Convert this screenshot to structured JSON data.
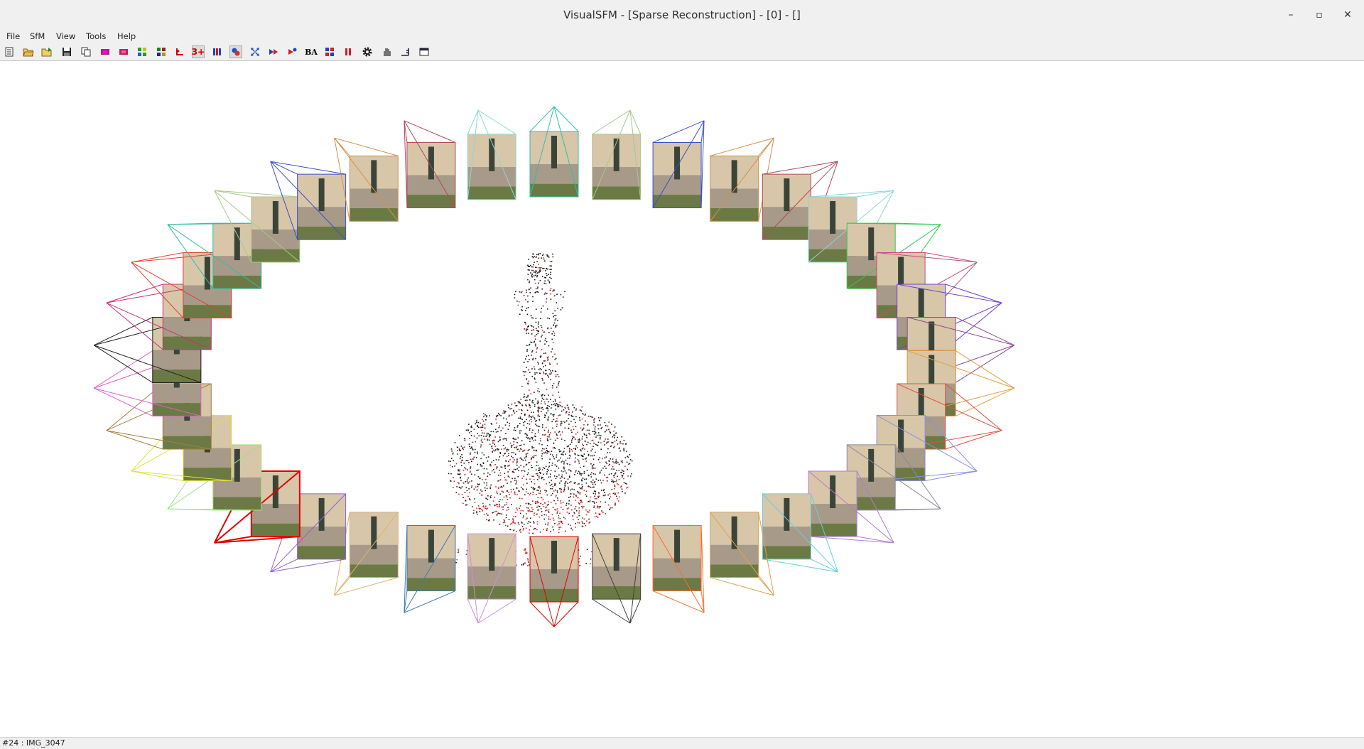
{
  "window": {
    "title": "VisualSFM - [Sparse Reconstruction] - [0] - []"
  },
  "menu": [
    "File",
    "SfM",
    "View",
    "Tools",
    "Help"
  ],
  "toolbar": {
    "buttons": [
      "new-log-icon",
      "open-icon",
      "open-multi-icon",
      "save-icon",
      "copy-icon",
      "pairwise-match-icon",
      "compute-missing-match-icon",
      "show-match-matrix-icon",
      "image-thumbnail-icon",
      "three-plus-icon",
      "feature-icon",
      "n-view-icon",
      "fit-view-icon",
      "sparse-reconstruction-icon",
      "resume-reconstruction-icon",
      "bundle-adjustment-label",
      "dense-reconstruction-icon",
      "pause-icon",
      "settings-icon",
      "hand-icon",
      "ruler-icon",
      "window-icon"
    ],
    "ba_label": "BA",
    "three_plus_label": "3+"
  },
  "viewport": {
    "camera_count": 38,
    "selected_camera": 24,
    "camera_colors": [
      "#2ebfa8",
      "#a8c88a",
      "#3a4fc8",
      "#d4904a",
      "#b04a5a",
      "#8ad8d8",
      "#2ecc4a",
      "#c84a7a",
      "#7040c8",
      "#8c4a8a",
      "#e0a040",
      "#e05040",
      "#8a90e0",
      "#8a8a9a",
      "#b07ad0",
      "#60d0e0",
      "#e0a050",
      "#ff6a2a",
      "#404040",
      "#e00000",
      "#c890e0",
      "#3a7ab0",
      "#e0b070",
      "#9060d0",
      "#40d080",
      "#a0e080",
      "#e0e040",
      "#a08040",
      "#e060c8",
      "#202020",
      "#c8307a",
      "#e04030"
    ],
    "point_colors": [
      "#1a1a1a",
      "#d02020"
    ]
  },
  "status": {
    "text": "#24 : IMG_3047"
  }
}
